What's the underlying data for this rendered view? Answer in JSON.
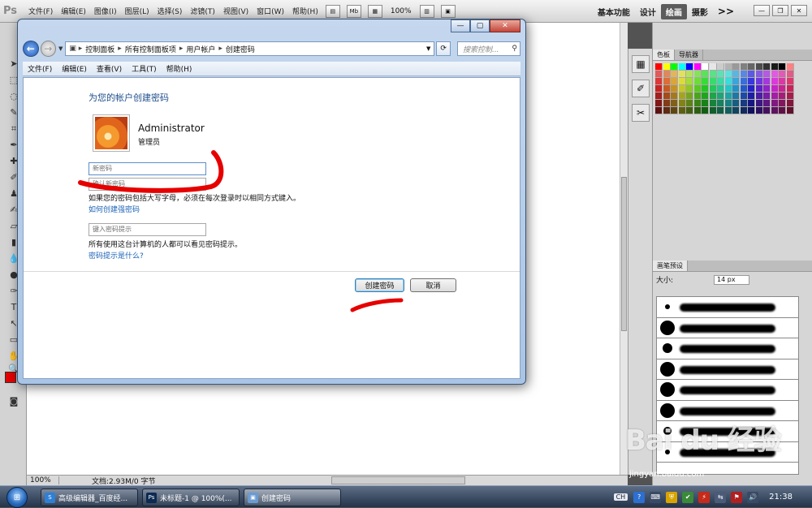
{
  "photoshop": {
    "logo": "Ps",
    "menu": [
      "文件(F)",
      "编辑(E)",
      "图像(I)",
      "图层(L)",
      "选择(S)",
      "滤镜(T)",
      "视图(V)",
      "窗口(W)",
      "帮助(H)"
    ],
    "mb_button": "Mb",
    "zoom": "100%",
    "workspaces": [
      "基本功能",
      "设计",
      "绘画",
      "摄影"
    ],
    "active_workspace": "绘画",
    "more": ">>",
    "status_zoom": "100%",
    "status_doc": "文档:2.93M/0 字节",
    "panels": {
      "swatches_tabs": [
        "色板",
        "导航器"
      ],
      "brush_tab": "画笔预设",
      "brush_size_label": "大小:",
      "brush_size_value": "14 px"
    }
  },
  "dialog": {
    "address_crumbs": [
      "控制面板",
      "所有控制面板项",
      "用户帐户",
      "创建密码"
    ],
    "search_placeholder": "搜索控制...",
    "menu": [
      "文件(F)",
      "编辑(E)",
      "查看(V)",
      "工具(T)",
      "帮助(H)"
    ],
    "heading": "为您的帐户创建密码",
    "account_name": "Administrator",
    "account_role": "管理员",
    "new_password_placeholder": "新密码",
    "confirm_password_placeholder": "确认新密码",
    "case_info": "如果您的密码包括大写字母，必须在每次登录时以相同方式键入。",
    "strong_password_link": "如何创建强密码",
    "hint_placeholder": "键入密码提示",
    "hint_info": "所有使用这台计算机的人都可以看见密码提示。",
    "hint_link": "密码提示是什么?",
    "create_button": "创建密码",
    "cancel_button": "取消"
  },
  "taskbar": {
    "buttons": [
      "高级编辑器_百度经...",
      "未标题-1 @ 100%(...",
      "创建密码"
    ],
    "lang": "CH",
    "clock": "21:38"
  },
  "watermark": {
    "text": "Bai du 经验",
    "url": "jingyan.baidu.com"
  },
  "colors": {
    "accent_red": "#e60000",
    "link_blue": "#1962b6",
    "heading_blue": "#1e4e8c"
  }
}
